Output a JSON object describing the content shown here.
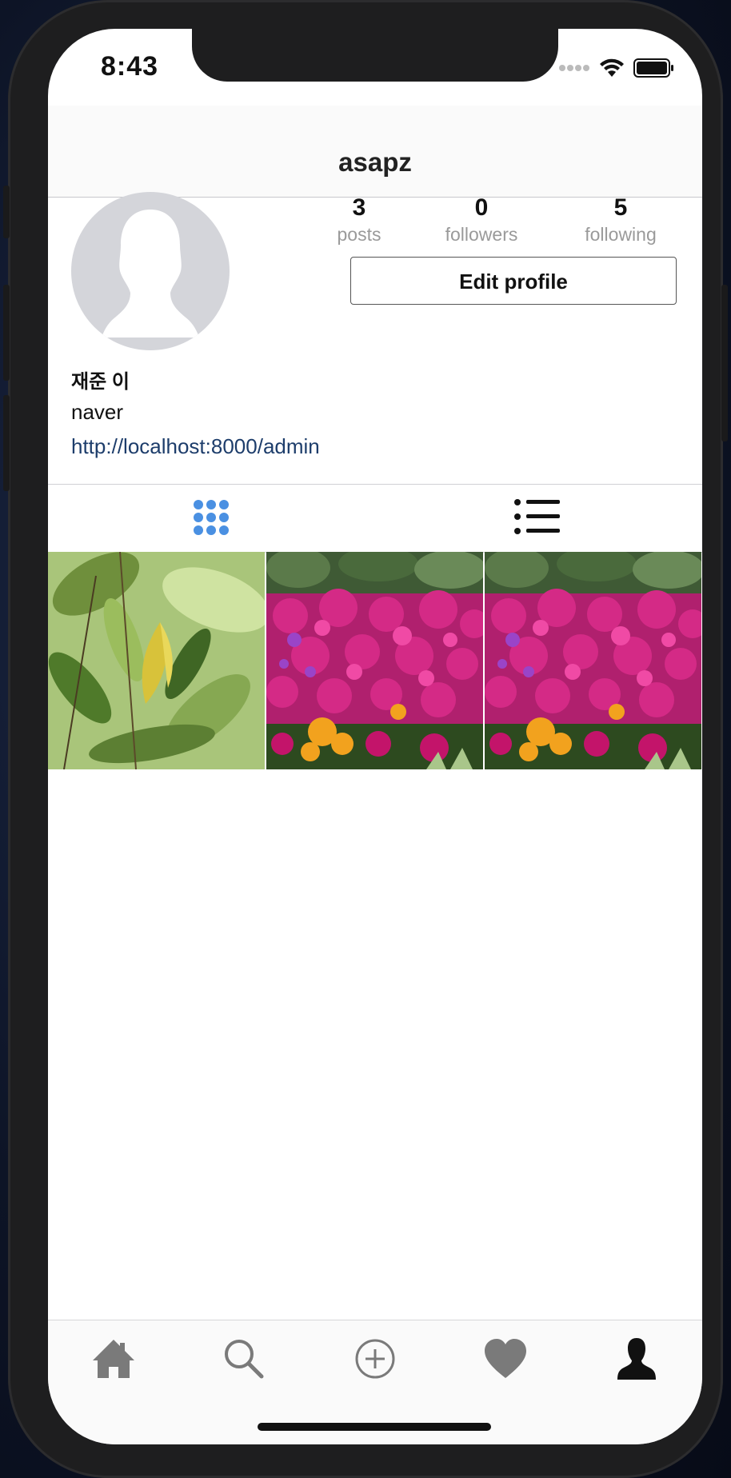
{
  "status_bar": {
    "time": "8:43"
  },
  "header": {
    "username": "asapz"
  },
  "profile": {
    "stats": [
      {
        "value": "3",
        "label": "posts"
      },
      {
        "value": "0",
        "label": "followers"
      },
      {
        "value": "5",
        "label": "following"
      }
    ],
    "edit_button_label": "Edit profile",
    "display_name": "재준 이",
    "bio": "naver",
    "website": "http://localhost:8000/admin"
  },
  "view_tabs": {
    "active": "grid",
    "items": [
      "grid-icon",
      "list-icon"
    ],
    "active_color": "#4a90e2"
  },
  "posts": [
    {
      "subject": "green leaves with a yellow leaf"
    },
    {
      "subject": "magenta flower bed with orange blossoms"
    },
    {
      "subject": "magenta flower bed with orange blossoms"
    }
  ],
  "bottom_nav": {
    "items": [
      "home-icon",
      "search-icon",
      "add-icon",
      "heart-icon",
      "profile-icon"
    ],
    "active": "profile-icon"
  }
}
